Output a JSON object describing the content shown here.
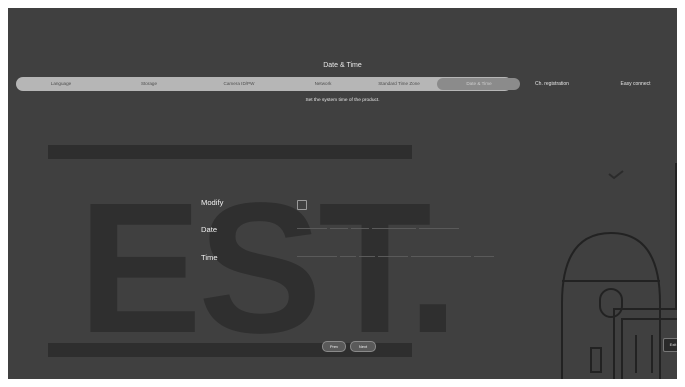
{
  "header": {
    "title": "Date & Time",
    "subtitle": "Set the system time of the product."
  },
  "wizard": {
    "steps": [
      {
        "label": "Language"
      },
      {
        "label": "Storage"
      },
      {
        "label": "Camera ID/PW"
      },
      {
        "label": "Network"
      },
      {
        "label": "Standard Time Zone"
      },
      {
        "label": "Date & Time",
        "active": true
      }
    ],
    "extra_steps": [
      {
        "label": "Ch. registration"
      },
      {
        "label": "Easy connect"
      }
    ]
  },
  "form": {
    "modify_label": "Modify",
    "modify_checked": false,
    "date_label": "Date",
    "time_label": "Time"
  },
  "buttons": {
    "prev": "Prev",
    "next": "Next",
    "exit": "Exit"
  },
  "background": {
    "letters": "EST."
  },
  "colors": {
    "screen_bg": "#404040",
    "step_bar": "#b6b6b6",
    "active_step": "#8b8b8b"
  }
}
